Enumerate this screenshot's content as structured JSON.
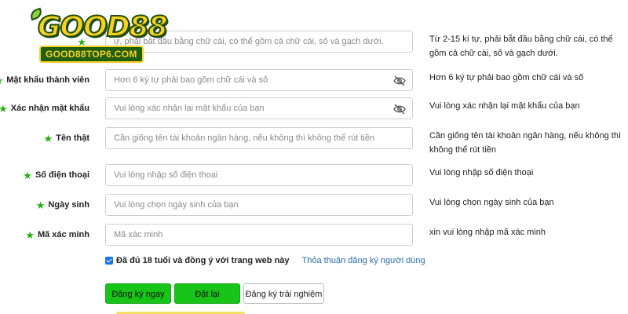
{
  "logo": {
    "text": "GOOD88",
    "subtitle": "GOOD88TOP6.COM"
  },
  "fields": [
    {
      "id": "username",
      "label": "",
      "placeholder": "ự, phải bắt đầu bằng chữ cái, có thể  gồm cả chữ cái, số và gạch dưới.",
      "hint": "Từ 2-15 kí tự, phải bắt đầu bằng chữ cái, có thể gồm cả chữ cái, số và gạch dưới.",
      "eye": false
    },
    {
      "id": "password",
      "label": "Mật khẩu thành viên",
      "placeholder": "Hơn 6 ký tự phải bao gồm chữ cái và số",
      "hint": "Hơn 6 ký tự phải bao gồm chữ cái và số",
      "eye": true
    },
    {
      "id": "confirm",
      "label": "Xác nhận mật khẩu",
      "placeholder": "Vui lòng xác nhận lại mật khẩu của bạn",
      "hint": "Vui lòng xác nhận lại mật khẩu của bạn",
      "eye": true
    },
    {
      "id": "realname",
      "label": "Tên thật",
      "placeholder": "Cần giống tên tài khoản ngân hàng, nếu không thì không thể rút tiền",
      "hint": "Cần giống tên tài khoản ngân hàng, nếu không thì không thể rút tiền",
      "eye": false
    },
    {
      "id": "phone",
      "label": "Số điện thoại",
      "placeholder": "Vui lòng nhập số điện thoại",
      "hint": "Vui lòng nhập số điện thoại",
      "eye": false
    },
    {
      "id": "birthday",
      "label": "Ngày sinh",
      "placeholder": "Vui lòng chọn ngày sinh của bạn",
      "hint": "Vui lòng chọn ngày sinh của bạn",
      "eye": false
    },
    {
      "id": "captcha",
      "label": "Mã xác minh",
      "placeholder": "Mã xác minh",
      "hint": "xin vui lòng nhập mã xác minh",
      "eye": false
    }
  ],
  "agreement": {
    "checked": true,
    "text": "Đã đủ 18 tuổi và đồng ý với trang web này",
    "link": "Thỏa thuận đăng ký người dùng"
  },
  "buttons": {
    "register": "Đăng ký ngay",
    "reset": "Đặt lại",
    "trial": "Đăng ký trải nghiệm"
  },
  "colors": {
    "accent_green": "#17c417",
    "star_green": "#22b010",
    "link_blue": "#2a6fb0"
  },
  "icons": {
    "required": "star-icon",
    "password_toggle": "eye-slash-icon"
  }
}
